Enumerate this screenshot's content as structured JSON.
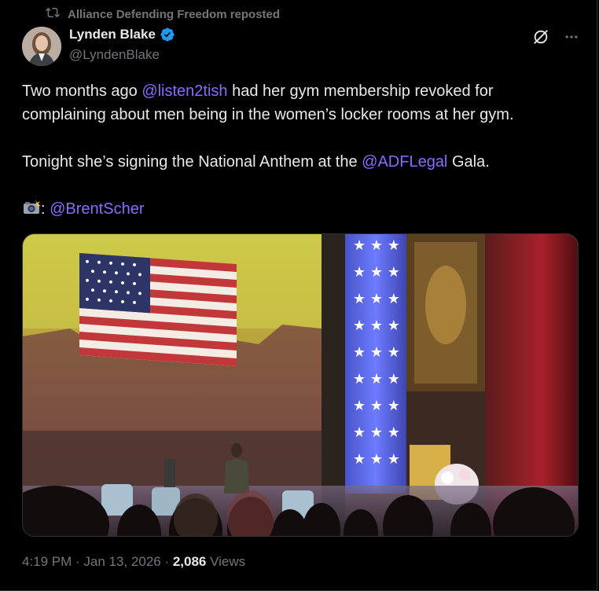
{
  "repost": {
    "label": "Alliance Defending Freedom reposted",
    "icon": "repost-icon"
  },
  "author": {
    "display_name": "Lynden Blake",
    "handle": "@LyndenBlake",
    "verified": true,
    "verified_color": "#1d9bf0"
  },
  "tweet": {
    "line1_pre": "Two months ago ",
    "mention1": "@listen2tish",
    "line1_post": " had her gym membership revoked for complaining about men being in the women’s locker rooms at her gym.",
    "line2_pre": "Tonight she’s signing the National Anthem at the ",
    "mention2": "@ADFLegal",
    "line2_post": " Gala.",
    "photo_credit_sep": ": ",
    "mention3": "@BrentScher"
  },
  "meta": {
    "time": "4:19 PM",
    "date": "Jan 13, 2026",
    "views_count": "2,086",
    "views_label": "Views",
    "sep": " · "
  },
  "colors": {
    "mention": "#8a6cff",
    "muted": "#71767b",
    "text": "#e7e9ea",
    "background": "#000000"
  },
  "icons": {
    "grok": "grok-icon",
    "more": "more-icon",
    "camera": "camera-flash-icon"
  }
}
